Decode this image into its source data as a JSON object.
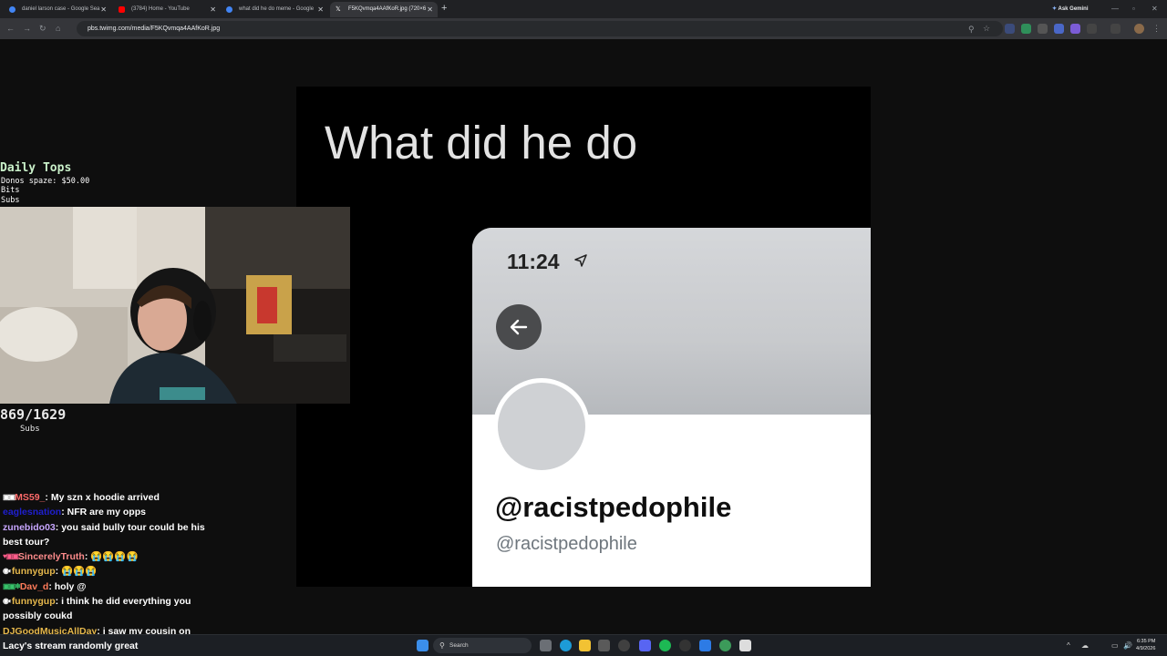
{
  "browser": {
    "tabs": [
      {
        "title": "daniel larson case - Google Sea",
        "favicon_color": "#4285f4",
        "active": false
      },
      {
        "title": "(3784) Home - YouTube",
        "favicon_color": "#ff0000",
        "active": false
      },
      {
        "title": "what did he do meme - Google",
        "favicon_color": "#4285f4",
        "active": false
      },
      {
        "title": "F5KQvmqa4AAfKoR.jpg (720×6",
        "favicon_color": "#ffffff",
        "active": true
      }
    ],
    "new_tab_label": "+",
    "ask_gemini_label": "Ask Gemini",
    "url": "pbs.twimg.com/media/F5KQvmqa4AAfKoR.jpg"
  },
  "meme": {
    "caption": "What did he do",
    "clock": "11:24",
    "display_name": "@racistpedophile",
    "handle": "@racistpedophile"
  },
  "overlay": {
    "daily_tops_title": "Daily Tops",
    "donos_line": "Donos spaze: $50.00",
    "bits_line": "Bits",
    "subs_line": "Subs",
    "sub_count": "869/1629",
    "sub_label": "Subs"
  },
  "chat": [
    {
      "badges": "▣▣",
      "user": "MS59_",
      "color": "#ff6a6a",
      "text": "My szn x hoodie arrived"
    },
    {
      "badges": "",
      "user": "eaglesnation",
      "color": "#1f1fd0",
      "text": "NFR are my opps"
    },
    {
      "badges": "",
      "user": "zunebido03",
      "color": "#c7a6ff",
      "text": "you said bully tour could be his best tour?"
    },
    {
      "badges": "♥▣▣",
      "user": "SincerelyTruth",
      "color": "#ff8c8c",
      "text": "😭😭😭😭"
    },
    {
      "badges": "◉◐",
      "user": "funnygup",
      "color": "#e6b84c",
      "text": "😭😭😭"
    },
    {
      "badges": "▣▣❄",
      "user": "Dav_d",
      "color": "#ff7b5a",
      "text": "holy @"
    },
    {
      "badges": "◉◐",
      "user": "funnygup",
      "color": "#e6b84c",
      "text": "i think he did everything you possibly coukd"
    },
    {
      "badges": "",
      "user": "DJGoodMusicAllDay",
      "color": "#e6b84c",
      "text": "i saw my cousin on"
    }
  ],
  "taskbar": {
    "search_label": "Search",
    "time": "6:35 PM",
    "date": "4/9/2026",
    "weather_text": "Lacy's stream randomly great"
  }
}
